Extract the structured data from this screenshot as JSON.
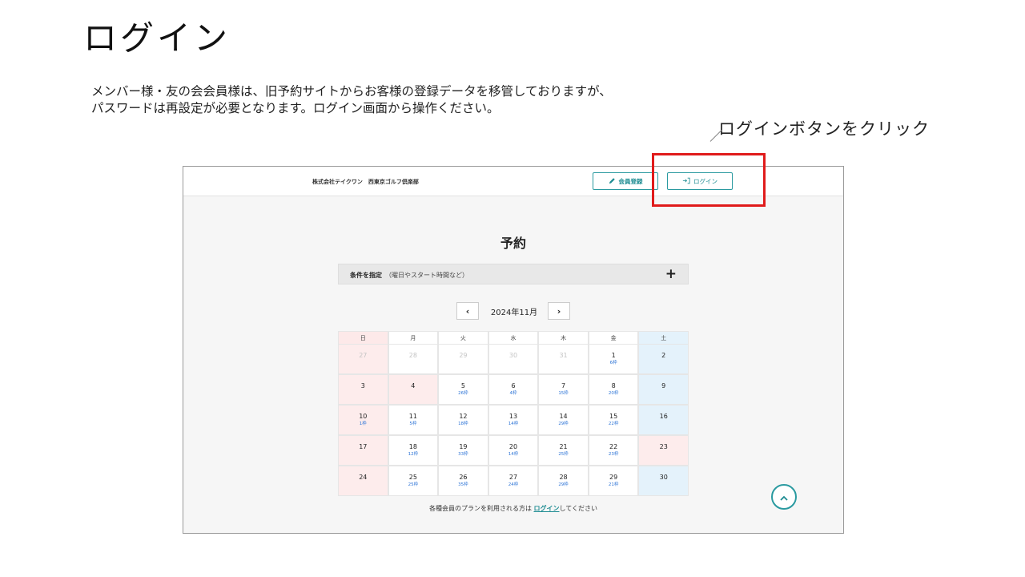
{
  "slide": {
    "title": "ログイン",
    "desc_line1": "メンバー様・友の会会員様は、旧予約サイトからお客様の登録データを移管しておりますが、",
    "desc_line2": "パスワードは再設定が必要となります。ログイン画面から操作ください。",
    "callout": "ログインボタンをクリック",
    "highlight_color": "#e01b1b"
  },
  "header": {
    "company": "株式会社テイクワン　西東京ゴルフ倶楽部",
    "register_label": "会員登録",
    "login_label": "ログイン",
    "accent": "#2a9aa0"
  },
  "main": {
    "title": "予約",
    "filter_label": "条件を指定",
    "filter_sub": "（曜日やスタート時間など）",
    "filter_toggle": "+",
    "month": "2024年11月",
    "prev": "‹",
    "next": "›"
  },
  "calendar": {
    "weekdays": [
      "日",
      "月",
      "火",
      "水",
      "木",
      "金",
      "土"
    ],
    "weeks": [
      [
        {
          "day": "27",
          "slots": "",
          "type": "sun past"
        },
        {
          "day": "28",
          "slots": "",
          "type": "past"
        },
        {
          "day": "29",
          "slots": "",
          "type": "past"
        },
        {
          "day": "30",
          "slots": "",
          "type": "past"
        },
        {
          "day": "31",
          "slots": "",
          "type": "past"
        },
        {
          "day": "1",
          "slots": "6枠",
          "type": ""
        },
        {
          "day": "2",
          "slots": "",
          "type": "sat"
        }
      ],
      [
        {
          "day": "3",
          "slots": "",
          "type": "sun"
        },
        {
          "day": "4",
          "slots": "",
          "type": "hol"
        },
        {
          "day": "5",
          "slots": "26枠",
          "type": ""
        },
        {
          "day": "6",
          "slots": "4枠",
          "type": ""
        },
        {
          "day": "7",
          "slots": "15枠",
          "type": ""
        },
        {
          "day": "8",
          "slots": "20枠",
          "type": ""
        },
        {
          "day": "9",
          "slots": "",
          "type": "sat"
        }
      ],
      [
        {
          "day": "10",
          "slots": "1枠",
          "type": "sun"
        },
        {
          "day": "11",
          "slots": "5枠",
          "type": ""
        },
        {
          "day": "12",
          "slots": "18枠",
          "type": ""
        },
        {
          "day": "13",
          "slots": "14枠",
          "type": ""
        },
        {
          "day": "14",
          "slots": "29枠",
          "type": ""
        },
        {
          "day": "15",
          "slots": "22枠",
          "type": ""
        },
        {
          "day": "16",
          "slots": "",
          "type": "sat"
        }
      ],
      [
        {
          "day": "17",
          "slots": "",
          "type": "sun"
        },
        {
          "day": "18",
          "slots": "12枠",
          "type": ""
        },
        {
          "day": "19",
          "slots": "33枠",
          "type": ""
        },
        {
          "day": "20",
          "slots": "14枠",
          "type": ""
        },
        {
          "day": "21",
          "slots": "25枠",
          "type": ""
        },
        {
          "day": "22",
          "slots": "23枠",
          "type": ""
        },
        {
          "day": "23",
          "slots": "",
          "type": "hol"
        }
      ],
      [
        {
          "day": "24",
          "slots": "",
          "type": "sun"
        },
        {
          "day": "25",
          "slots": "25枠",
          "type": ""
        },
        {
          "day": "26",
          "slots": "35枠",
          "type": ""
        },
        {
          "day": "27",
          "slots": "24枠",
          "type": ""
        },
        {
          "day": "28",
          "slots": "29枠",
          "type": ""
        },
        {
          "day": "29",
          "slots": "21枠",
          "type": ""
        },
        {
          "day": "30",
          "slots": "",
          "type": "sat"
        }
      ]
    ]
  },
  "footer": {
    "before": "各種会員のプランを利用される方は ",
    "link": "ログイン",
    "after": "してください"
  },
  "icons": {
    "register": "pencil-icon",
    "login": "login-arrow-icon",
    "scroll_top": "chevron-up-icon"
  }
}
